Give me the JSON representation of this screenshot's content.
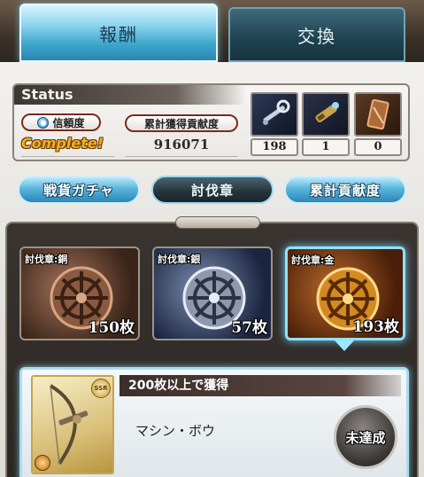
{
  "tabs": [
    {
      "label": "報酬",
      "active": true
    },
    {
      "label": "交換",
      "active": false
    }
  ],
  "status": {
    "title": "Status",
    "trust_label": "信頼度",
    "trust_value": "Complete!",
    "contribution_label": "累計獲得貢献度",
    "contribution_value": "916071",
    "items": [
      {
        "icon": "wrench-icon",
        "count": "198"
      },
      {
        "icon": "spyglass-icon",
        "count": "1"
      },
      {
        "icon": "card-icon",
        "count": "0"
      }
    ]
  },
  "sub_tabs": [
    {
      "label": "戦貨ガチャ",
      "active": false
    },
    {
      "label": "討伐章",
      "active": true
    },
    {
      "label": "累計貢献度",
      "active": false
    }
  ],
  "medals": [
    {
      "tag": "討伐章:銅",
      "count": "150枚",
      "icon": "bronze-wheel-medal-icon",
      "selected": false
    },
    {
      "tag": "討伐章:銀",
      "count": "57枚",
      "icon": "silver-wheel-medal-icon",
      "selected": false
    },
    {
      "tag": "討伐章:金",
      "count": "193枚",
      "icon": "gold-wheel-medal-icon",
      "selected": true
    }
  ],
  "reward": {
    "condition": "200枚以上で獲得",
    "name": "マシン・ボウ",
    "rarity": "SSR",
    "status_label": "未達成",
    "icon": "machine-bow-icon"
  },
  "colors": {
    "accent_blue": "#58b6dc",
    "complete_gold": "#f3b21e",
    "panel_dark": "#2a2522"
  }
}
